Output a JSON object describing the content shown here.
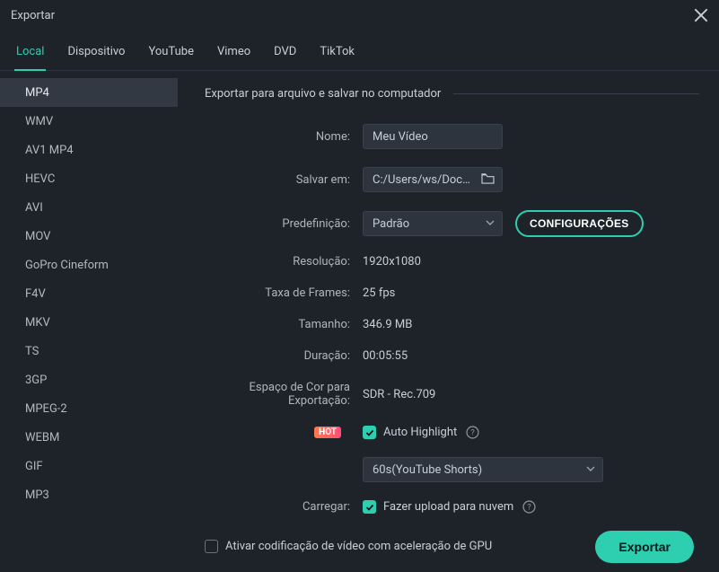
{
  "window": {
    "title": "Exportar"
  },
  "tabs": [
    {
      "label": "Local",
      "active": true
    },
    {
      "label": "Dispositivo",
      "active": false
    },
    {
      "label": "YouTube",
      "active": false
    },
    {
      "label": "Vimeo",
      "active": false
    },
    {
      "label": "DVD",
      "active": false
    },
    {
      "label": "TikTok",
      "active": false
    }
  ],
  "formats": [
    "MP4",
    "WMV",
    "AV1 MP4",
    "HEVC",
    "AVI",
    "MOV",
    "GoPro Cineform",
    "F4V",
    "MKV",
    "TS",
    "3GP",
    "MPEG-2",
    "WEBM",
    "GIF",
    "MP3"
  ],
  "formats_active_index": 0,
  "section_title": "Exportar para arquivo e salvar no computador",
  "fields": {
    "name_label": "Nome:",
    "name_value": "Meu Vídeo",
    "save_label": "Salvar em:",
    "save_value": "C:/Users/ws/Documents",
    "preset_label": "Predefinição:",
    "preset_value": "Padrão",
    "config_button": "CONFIGURAÇÕES",
    "resolution_label": "Resolução:",
    "resolution_value": "1920x1080",
    "framerate_label": "Taxa de Frames:",
    "framerate_value": "25 fps",
    "size_label": "Tamanho:",
    "size_value": "346.9 MB",
    "duration_label": "Duração:",
    "duration_value": "00:05:55",
    "colorspace_label": "Espaço de Cor para Exportação:",
    "colorspace_value": "SDR - Rec.709",
    "hot_badge": "HOT",
    "auto_highlight_label": "Auto Highlight",
    "auto_highlight_checked": true,
    "highlight_preset": "60s(YouTube Shorts)",
    "upload_label": "Carregar:",
    "upload_text": "Fazer upload para nuvem",
    "upload_checked": true
  },
  "footer": {
    "gpu_label": "Ativar codificação de vídeo com aceleração de GPU",
    "gpu_checked": false,
    "export_button": "Exportar"
  },
  "colors": {
    "accent": "#2ecfb0",
    "bg": "#1e2329",
    "input_bg": "#2d343e"
  }
}
